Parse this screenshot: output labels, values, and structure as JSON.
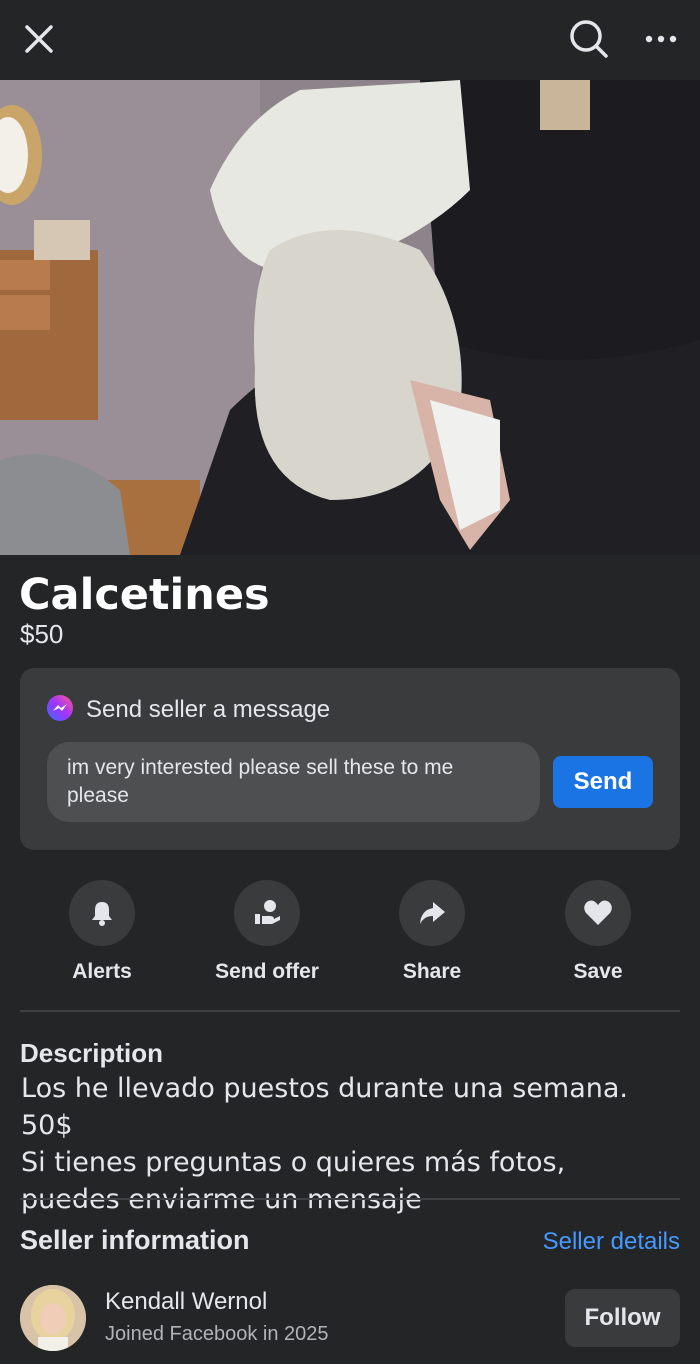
{
  "topbar": {
    "close_icon": "close-icon",
    "search_icon": "search-icon",
    "more_icon": "more-icon"
  },
  "listing": {
    "photo": "listing-photo",
    "title": "Calcetines",
    "price": "$50"
  },
  "message": {
    "header": "Send seller a message",
    "icon": "messenger-icon",
    "input_value": "im very interested please sell these to me please",
    "send_label": "Send",
    "send_color": "#1b74e4"
  },
  "actions": [
    {
      "label": "Alerts",
      "icon": "bell-icon"
    },
    {
      "label": "Send offer",
      "icon": "offer-icon"
    },
    {
      "label": "Share",
      "icon": "share-icon"
    },
    {
      "label": "Save",
      "icon": "heart-icon"
    }
  ],
  "description": {
    "heading": "Description",
    "line1": "Los he llevado puestos durante una semana. 50$",
    "line2": "Si tienes preguntas o quieres más fotos, puedes enviarme un mensaje"
  },
  "seller": {
    "heading": "Seller information",
    "details_link": "Seller details",
    "name": "Kendall Wernol",
    "joined": "Joined Facebook in 2025",
    "follow_label": "Follow",
    "link_color": "#4599ff"
  }
}
